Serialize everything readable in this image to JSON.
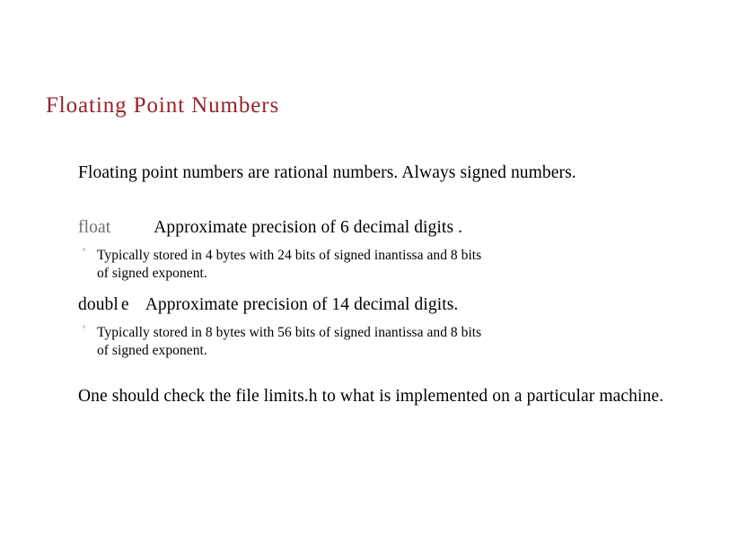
{
  "slide": {
    "title": "Floating Point Numbers",
    "title_color": "#97222a",
    "background_color": "#ffffff",
    "body_color": "#000000",
    "keyword_gray_color": "#6e6e6e",
    "bullet_marker": "°",
    "bullet_color": "#8a7a44"
  },
  "content": {
    "intro": "Floating point numbers are rational numbers. Always signed numbers.",
    "float_keyword": "float",
    "float_description": "Approximate precision of 6 decimal digits .",
    "float_detail_line1": "Typically stored in 4 bytes with 24 bits of signed inantissa and 8 bits",
    "float_detail_line2": "of signed exponent.",
    "double_keyword_part1": "doubl",
    "double_keyword_part2": "e",
    "double_description": "Approximate precision of 14 decimal digits.",
    "double_detail_line1": "Typically stored in 8 bytes with 56 bits of signed inantissa and 8 bits",
    "double_detail_line2": "of signed exponent.",
    "closing": "One should check the file limits.h to what is  implemented on a particular  machine."
  }
}
